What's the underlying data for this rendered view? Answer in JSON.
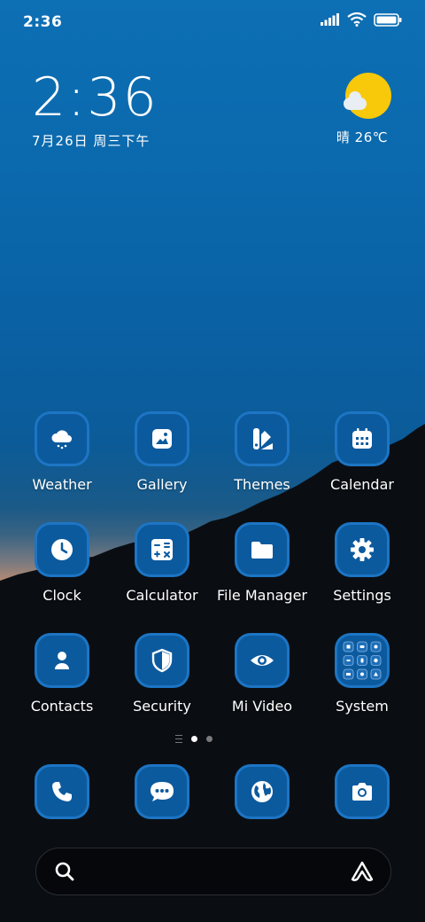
{
  "statusbar": {
    "time": "2:36"
  },
  "clock_widget": {
    "time": "2:36",
    "date": "7月26日 周三下午"
  },
  "weather_widget": {
    "text": "晴 26℃",
    "icon": "sun-cloud-icon"
  },
  "apps": [
    {
      "label": "Weather",
      "icon": "weather-snow-icon"
    },
    {
      "label": "Gallery",
      "icon": "gallery-icon"
    },
    {
      "label": "Themes",
      "icon": "themes-icon"
    },
    {
      "label": "Calendar",
      "icon": "calendar-icon"
    },
    {
      "label": "Clock",
      "icon": "clock-icon"
    },
    {
      "label": "Calculator",
      "icon": "calculator-icon"
    },
    {
      "label": "File Manager",
      "icon": "folder-icon"
    },
    {
      "label": "Settings",
      "icon": "gear-icon"
    },
    {
      "label": "Contacts",
      "icon": "contacts-icon"
    },
    {
      "label": "Security",
      "icon": "shield-icon"
    },
    {
      "label": "Mi Video",
      "icon": "eye-icon"
    },
    {
      "label": "System",
      "icon": "folder-grid-icon"
    }
  ],
  "dock": [
    {
      "icon": "phone-icon"
    },
    {
      "icon": "messages-icon"
    },
    {
      "icon": "browser-globe-icon"
    },
    {
      "icon": "camera-icon"
    }
  ],
  "colors": {
    "icon_border": "#1d75c4",
    "icon_fill": "#0c5a9e",
    "sun": "#f8c80a"
  }
}
